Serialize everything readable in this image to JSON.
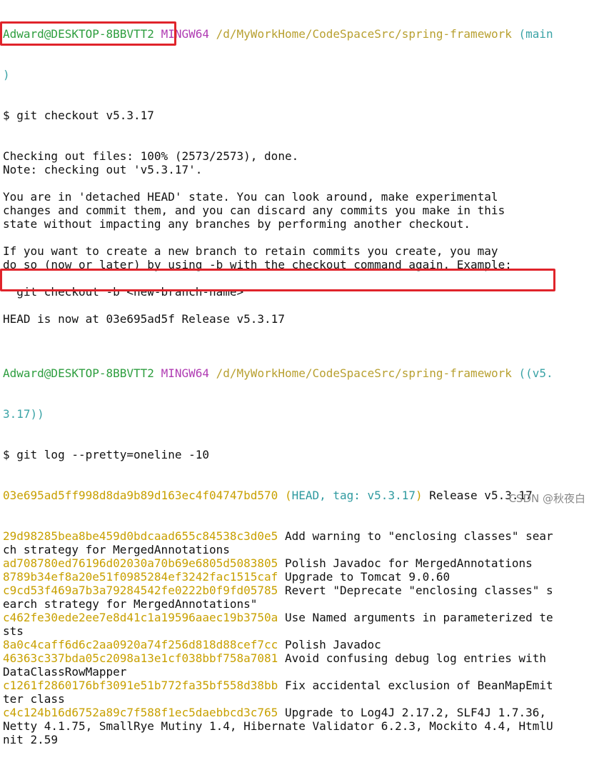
{
  "prompt1": {
    "user": "Adward@DESKTOP-8BBVTT2",
    "env": "MINGW64",
    "path": "/d/MyWorkHome/CodeSpaceSrc/spring-framework",
    "branch": "(main",
    "branch_wrap": ")"
  },
  "cmd1": "$ git checkout v5.3.17",
  "out1": [
    "Checking out files: 100% (2573/2573), done.",
    "Note: checking out 'v5.3.17'.",
    "",
    "You are in 'detached HEAD' state. You can look around, make experimental",
    "changes and commit them, and you can discard any commits you make in this",
    "state without impacting any branches by performing another checkout.",
    "",
    "If you want to create a new branch to retain commits you create, you may",
    "do so (now or later) by using -b with the checkout command again. Example:",
    "",
    "  git checkout -b <new-branch-name>",
    "",
    "HEAD is now at 03e695ad5f Release v5.3.17",
    ""
  ],
  "prompt2": {
    "user": "Adward@DESKTOP-8BBVTT2",
    "env": "MINGW64",
    "path": "/d/MyWorkHome/CodeSpaceSrc/spring-framework",
    "branch": "((v5.",
    "branch_wrap": "3.17))"
  },
  "cmd2": "$ git log --pretty=oneline -10",
  "log_head": {
    "hash": "03e695ad5ff998d8da9b89d163ec4f04747bd570",
    "open": " (",
    "refs": "HEAD, tag: v5.3.17",
    "close": ")",
    "msg": " Release v5.3.17"
  },
  "log": [
    {
      "hash": "29d98285bea8be459d0bdcaad655c84538c3d0e5",
      "msg": " Add warning to \"enclosing classes\" sear",
      "wrap": [
        "ch strategy for MergedAnnotations"
      ]
    },
    {
      "hash": "ad708780ed76196d02030a70b69e6805d5083805",
      "msg": " Polish Javadoc for MergedAnnotations",
      "wrap": []
    },
    {
      "hash": "8789b34ef8a20e51f0985284ef3242fac1515caf",
      "msg": " Upgrade to Tomcat 9.0.60",
      "wrap": []
    },
    {
      "hash": "c9cd53f469a7b3a79284542fe0222b0f9fd05785",
      "msg": " Revert \"Deprecate \"enclosing classes\" s",
      "wrap": [
        "earch strategy for MergedAnnotations\""
      ]
    },
    {
      "hash": "c462fe30ede2ee7e8d41c1a19596aaec19b3750a",
      "msg": " Use Named arguments in parameterized te",
      "wrap": [
        "sts"
      ]
    },
    {
      "hash": "8a0c4caff6d6c2aa0920a74f256d818d88cef7cc",
      "msg": " Polish Javadoc",
      "wrap": []
    },
    {
      "hash": "46363c337bda05c2098a13e1cf038bbf758a7081",
      "msg": " Avoid confusing debug log entries with",
      "wrap": [
        "DataClassRowMapper"
      ]
    },
    {
      "hash": "c1261f2860176bf3091e51b772fa35bf558d38bb",
      "msg": " Fix accidental exclusion of BeanMapEmit",
      "wrap": [
        "ter class"
      ]
    },
    {
      "hash": "c4c124b16d6752a89c7f588f1ec5daebbcd3c765",
      "msg": " Upgrade to Log4J 2.17.2, SLF4J 1.7.36,",
      "wrap": [
        "Netty 4.1.75, SmallRye Mutiny 1.4, Hibernate Validator 6.2.3, Mockito 4.4, HtmlU",
        "nit 2.59"
      ]
    }
  ],
  "watermark": "CSDN @秋夜白",
  "colors": {
    "user": "#2e9e3f",
    "env": "#b03cb3",
    "path": "#b8a030",
    "hash": "#c8a000",
    "highlight_box": "#e0242b"
  }
}
